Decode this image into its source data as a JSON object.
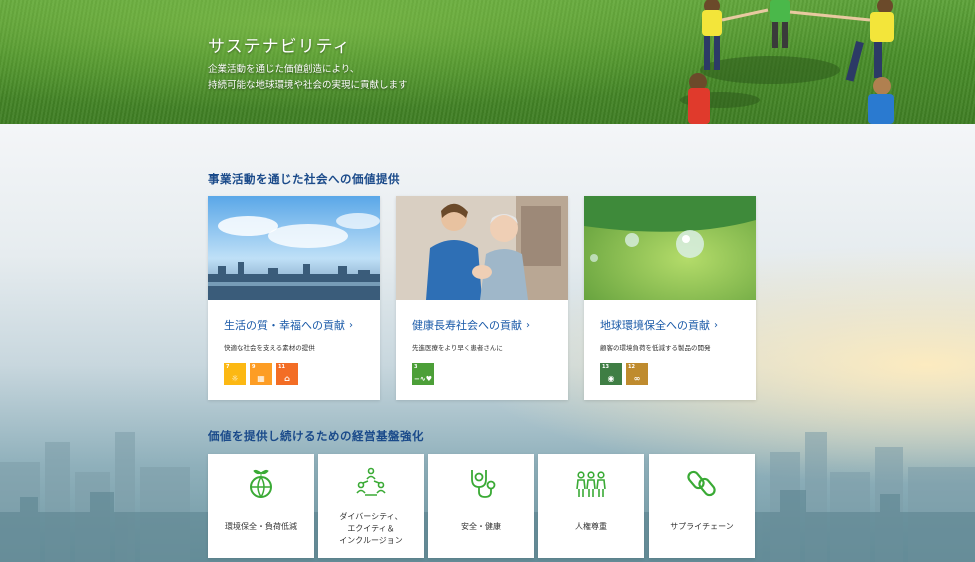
{
  "hero": {
    "title": "サステナビリティ",
    "subtitle_line1": "企業活動を通じた価値創造により、",
    "subtitle_line2": "持続可能な地球環境や社会の実現に貢献します"
  },
  "section1": {
    "title": "事業活動を通じた社会への価値提供",
    "cards": [
      {
        "link": "生活の質・幸福への貢献",
        "desc": "快適な社会を支える素材の提供",
        "sdgs": [
          {
            "num": "7",
            "color": "#fcb813",
            "glyph": "☼"
          },
          {
            "num": "9",
            "color": "#fd9d24",
            "glyph": "▦"
          },
          {
            "num": "11",
            "color": "#f36d25",
            "glyph": "⌂"
          }
        ]
      },
      {
        "link": "健康長寿社会への貢献",
        "desc": "先進医療をより早く患者さんに",
        "sdgs": [
          {
            "num": "3",
            "color": "#4c9f38",
            "glyph": "−∿♥"
          }
        ]
      },
      {
        "link": "地球環境保全への貢献",
        "desc": "顧客の環境負荷を低減する製品の開発",
        "sdgs": [
          {
            "num": "12",
            "color": "#bf8b2e",
            "glyph": "∞"
          },
          {
            "num": "13",
            "color": "#3f7e44",
            "glyph": "◉"
          }
        ]
      }
    ],
    "chevron": "›"
  },
  "section2": {
    "title": "価値を提供し続けるための経営基盤強化",
    "tiles": [
      {
        "line1": "環境保全・負荷低減"
      },
      {
        "line1": "ダイバーシティ、",
        "line2": "エクイティ＆",
        "line3": "インクルージョン"
      },
      {
        "line1": "安全・健康"
      },
      {
        "line1": "人権尊重"
      },
      {
        "line1": "サプライチェーン"
      }
    ]
  },
  "colors": {
    "accent": "#1a5aa8",
    "heading": "#1a4a8a",
    "icon_green": "#3aaa35"
  },
  "icons": [
    "globe-sprout-icon",
    "people-network-icon",
    "stethoscope-icon",
    "people-group-icon",
    "chain-link-icon"
  ]
}
